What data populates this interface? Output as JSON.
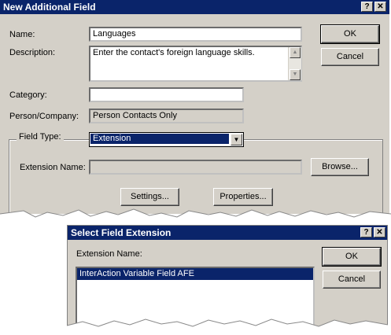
{
  "dialog1": {
    "title": "New Additional Field",
    "help_glyph": "?",
    "close_glyph": "✕",
    "name_label": "Name:",
    "name_value": "Languages",
    "description_label": "Description:",
    "description_value": "Enter the contact's foreign language skills.",
    "category_label": "Category:",
    "category_value": "",
    "person_company_label": "Person/Company:",
    "person_company_value": "Person Contacts Only",
    "field_type_label": "Field Type:",
    "field_type_value": "Extension",
    "extension_name_label": "Extension Name:",
    "extension_name_value": "",
    "ok_label": "OK",
    "cancel_label": "Cancel",
    "browse_label": "Browse...",
    "settings_label": "Settings...",
    "properties_label": "Properties..."
  },
  "dialog2": {
    "title": "Select Field Extension",
    "help_glyph": "?",
    "close_glyph": "✕",
    "extension_name_label": "Extension Name:",
    "items": [
      "InterAction Variable Field AFE"
    ],
    "ok_label": "OK",
    "cancel_label": "Cancel"
  },
  "colors": {
    "titlebar": "#0a246a",
    "dialog_face": "#d4d0c8",
    "selection": "#0a246a"
  },
  "icons": {
    "scroll_up": "scroll-up-arrow-icon",
    "scroll_down": "scroll-down-arrow-icon",
    "dropdown": "dropdown-arrow-icon"
  }
}
